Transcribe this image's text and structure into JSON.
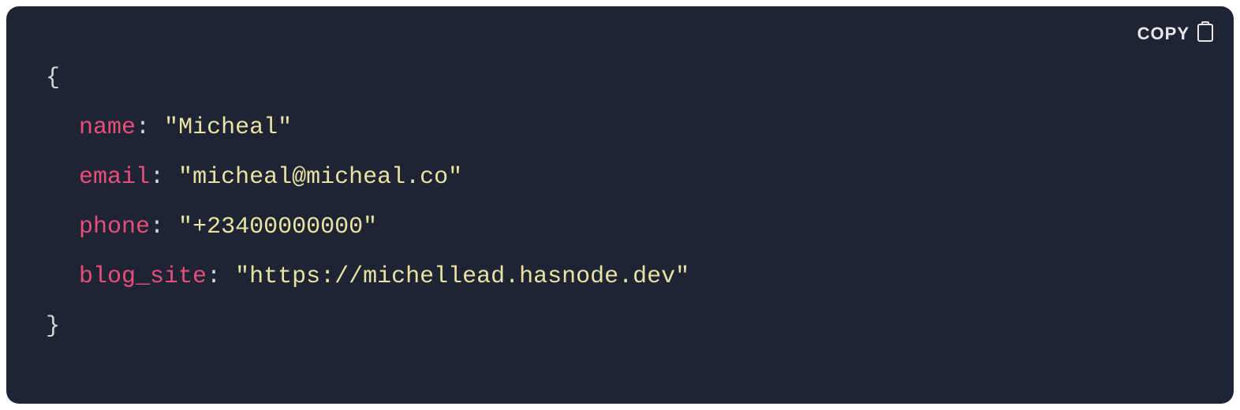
{
  "copy": {
    "label": "COPY"
  },
  "code": {
    "open_brace": "{",
    "close_brace": "}",
    "colon": ":",
    "space": " ",
    "quote": "\"",
    "entries": [
      {
        "key": "name",
        "value": "Micheal"
      },
      {
        "key": "email",
        "value": "micheal@micheal.co"
      },
      {
        "key": "phone",
        "value": "+23400000000"
      },
      {
        "key": "blog_site",
        "value": "https://michellead.hasnode.dev"
      }
    ]
  }
}
